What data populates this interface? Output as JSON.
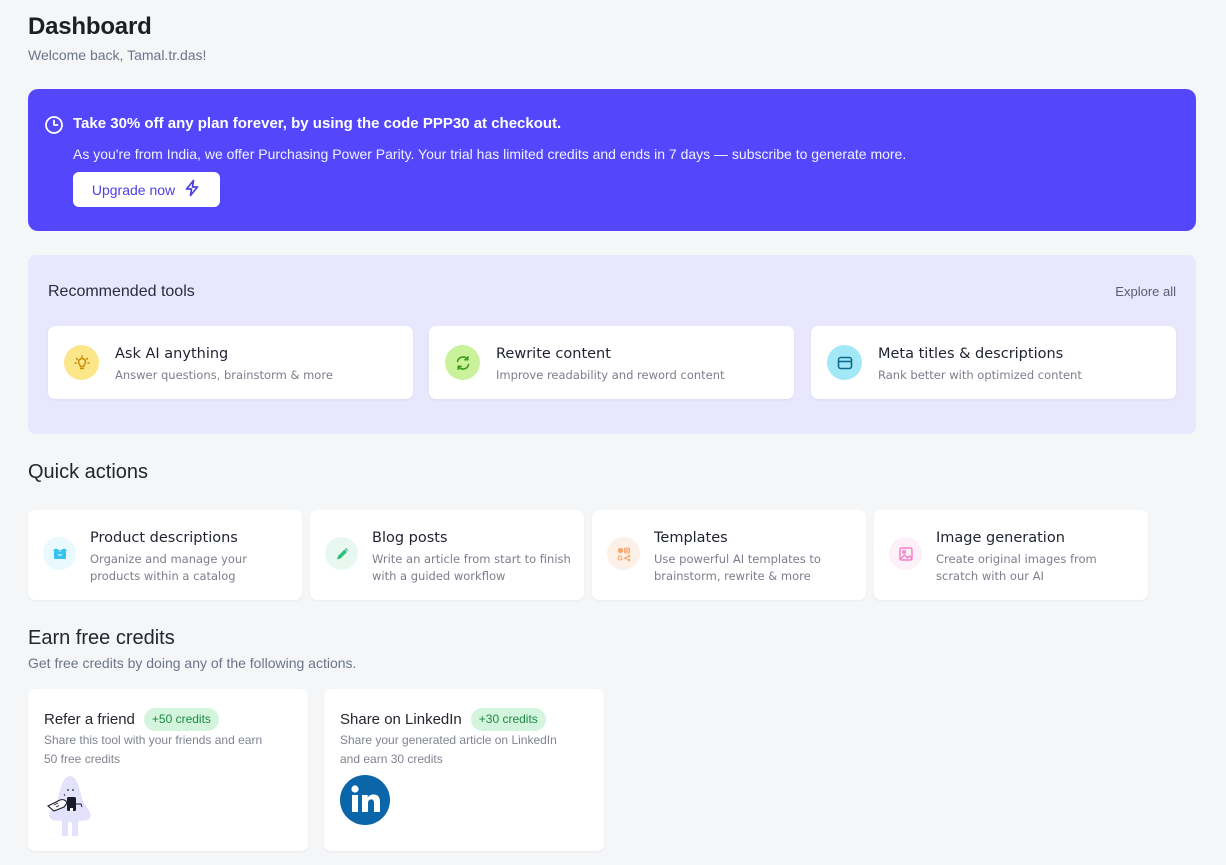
{
  "header": {
    "title": "Dashboard",
    "subtitle": "Welcome back, Tamal.tr.das!"
  },
  "promo": {
    "icon": "clock-icon",
    "headline_prefix": "Take 30% off any plan forever, by using the code ",
    "code": "PPP30",
    "headline_suffix": " at checkout.",
    "body": "As you're from India, we offer Purchasing Power Parity. Your trial has limited credits and ends in 7 days — subscribe to generate more.",
    "button_label": "Upgrade now",
    "button_icon": "lightning-icon",
    "background": "#5346fb"
  },
  "recommended": {
    "label": "Recommended tools",
    "explore_label": "Explore all",
    "tools": [
      {
        "title": "Ask AI anything",
        "desc": "Answer questions, brainstorm & more",
        "icon": "lightbulb-icon",
        "color": "#fbe68a"
      },
      {
        "title": "Rewrite content",
        "desc": "Improve readability and reword content",
        "icon": "refresh-icon",
        "color": "#c9f29b"
      },
      {
        "title": "Meta titles & descriptions",
        "desc": "Rank better with optimized content",
        "icon": "browser-window-icon",
        "color": "#a3e8f7"
      }
    ]
  },
  "quick_actions": {
    "heading": "Quick actions",
    "items": [
      {
        "title": "Product descriptions",
        "desc": "Organize and manage your products within a catalog",
        "icon": "box-icon"
      },
      {
        "title": "Blog posts",
        "desc": "Write an article from start to finish with a guided workflow",
        "icon": "pencil-icon"
      },
      {
        "title": "Templates",
        "desc": "Use powerful AI templates to brainstorm, rewrite & more",
        "icon": "social-templates-icon"
      },
      {
        "title": "Image generation",
        "desc": "Create original images from scratch with our AI",
        "icon": "image-icon"
      }
    ]
  },
  "earn_credits": {
    "heading": "Earn free credits",
    "subtitle": "Get free credits by doing any of the following actions.",
    "items": [
      {
        "title": "Refer a friend",
        "badge": "+50 credits",
        "desc_line1": "Share this tool with your friends and earn",
        "desc_line2": "50 free credits",
        "illustration": "refer-friend-illustration"
      },
      {
        "title": "Share on LinkedIn",
        "badge": "+30 credits",
        "desc_line1": "Share your generated article on LinkedIn",
        "desc_line2": "and earn 30 credits",
        "illustration": "linkedin-logo"
      }
    ]
  }
}
